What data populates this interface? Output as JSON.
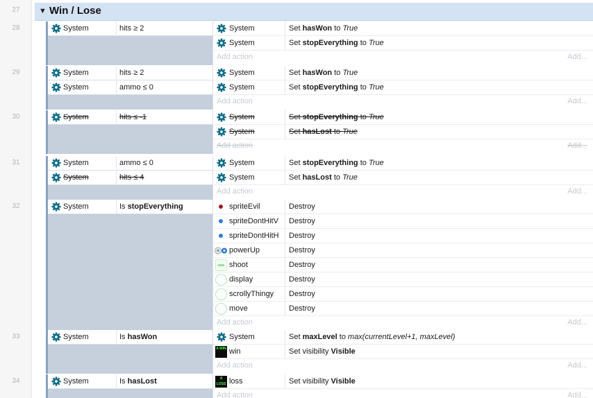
{
  "group": {
    "line": "27",
    "collapse_glyph": "▼",
    "title": "Win / Lose"
  },
  "accent": {
    "condition_panel": "#c6cfdc",
    "group_header": "#d4e3f4",
    "disabled_text": "#c5cad2"
  },
  "add_action": {
    "label": "Add action",
    "short_label": "Add..."
  },
  "events": [
    {
      "line": "28",
      "conditions": [
        {
          "object": "System",
          "text": "hits ≥ 2",
          "icon": "gear-icon"
        }
      ],
      "actions": [
        {
          "object": "System",
          "verb": "Set ",
          "var": "hasWon",
          "mid": " to ",
          "value": "True",
          "icon": "gear-icon"
        },
        {
          "object": "System",
          "verb": "Set ",
          "var": "stopEverything",
          "mid": " to ",
          "value": "True",
          "icon": "gear-icon"
        }
      ]
    },
    {
      "line": "29",
      "conditions": [
        {
          "object": "System",
          "text": "hits ≥ 2",
          "icon": "gear-icon"
        },
        {
          "object": "System",
          "text": "ammo ≤ 0",
          "icon": "gear-icon"
        }
      ],
      "actions": [
        {
          "object": "System",
          "verb": "Set ",
          "var": "hasWon",
          "mid": " to ",
          "value": "True",
          "icon": "gear-icon"
        },
        {
          "object": "System",
          "verb": "Set ",
          "var": "stopEverything",
          "mid": " to ",
          "value": "True",
          "icon": "gear-icon"
        }
      ]
    },
    {
      "line": "30",
      "disabled": true,
      "conditions": [
        {
          "object": "System",
          "text": "hits ≤ -1",
          "icon": "gear-icon"
        }
      ],
      "actions": [
        {
          "object": "System",
          "verb": "Set ",
          "var": "stopEverything",
          "mid": " to ",
          "value": "True",
          "icon": "gear-icon"
        },
        {
          "object": "System",
          "verb": "Set ",
          "var": "hasLost",
          "mid": " to ",
          "value": "True",
          "icon": "gear-icon"
        }
      ]
    },
    {
      "line": "31",
      "conditions": [
        {
          "object": "System",
          "text": "ammo ≤ 0",
          "icon": "gear-icon"
        },
        {
          "object": "System",
          "text": "hits ≤ 4",
          "icon": "gear-icon",
          "disabled": true
        }
      ],
      "actions": [
        {
          "object": "System",
          "verb": "Set ",
          "var": "stopEverything",
          "mid": " to ",
          "value": "True",
          "icon": "gear-icon"
        },
        {
          "object": "System",
          "verb": "Set ",
          "var": "hasLost",
          "mid": " to ",
          "value": "True",
          "icon": "gear-icon"
        }
      ]
    },
    {
      "line": "32",
      "conditions": [
        {
          "object": "System",
          "prefix": "Is ",
          "bold": "stopEverything",
          "icon": "gear-icon"
        }
      ],
      "actions": [
        {
          "object": "spriteEvil",
          "plain": "Destroy",
          "icon": "dot-icon",
          "color": "#9b1b2a"
        },
        {
          "object": "spriteDontHitV",
          "plain": "Destroy",
          "icon": "dot-icon",
          "color": "#2f7fd6"
        },
        {
          "object": "spriteDontHitH",
          "plain": "Destroy",
          "icon": "dot-icon",
          "color": "#2f7fd6"
        },
        {
          "object": "powerUp",
          "plain": "Destroy",
          "icon": "powerup-icon"
        },
        {
          "object": "shoot",
          "plain": "Destroy",
          "icon": "sprite-icon"
        },
        {
          "object": "display",
          "plain": "Destroy",
          "icon": "circle-icon"
        },
        {
          "object": "scrollyThingy",
          "plain": "Destroy",
          "icon": "circle-icon"
        },
        {
          "object": "move",
          "plain": "Destroy",
          "icon": "circle-icon"
        }
      ]
    },
    {
      "line": "33",
      "conditions": [
        {
          "object": "System",
          "prefix": "Is ",
          "bold": "hasWon",
          "icon": "gear-icon"
        }
      ],
      "actions": [
        {
          "object": "System",
          "verb": "Set ",
          "var": "maxLevel",
          "mid": " to ",
          "value": "max(currentLevel+1, maxLevel)",
          "icon": "gear-icon"
        },
        {
          "object": "win",
          "prefix": "Set visibility ",
          "bold": "Visible",
          "icon": "win-badge-icon",
          "badge": "A WIN"
        }
      ]
    },
    {
      "line": "34",
      "conditions": [
        {
          "object": "System",
          "prefix": "Is ",
          "bold": "hasLost",
          "icon": "gear-icon"
        }
      ],
      "actions": [
        {
          "object": "loss",
          "prefix": "Set visibility ",
          "bold": "Visible",
          "icon": "loss-badge-icon",
          "badge": "A LOSS"
        }
      ]
    }
  ]
}
